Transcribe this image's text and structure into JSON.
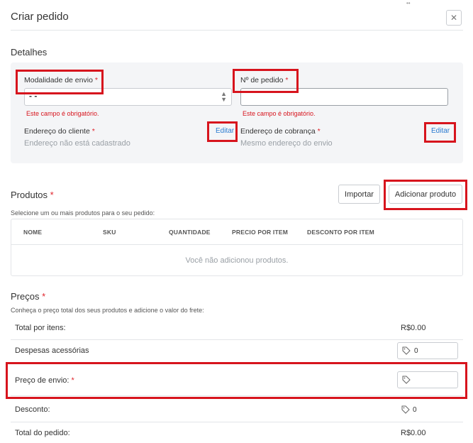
{
  "modal": {
    "title": "Criar pedido",
    "close_symbol": "✕"
  },
  "details": {
    "title": "Detalhes",
    "shipping_mode": {
      "label": "Modalidade de envio",
      "required": "*",
      "value": "- -",
      "error": "Este campo é obrigatório."
    },
    "order_number": {
      "label": "Nº de pedido",
      "required": "*",
      "value": "",
      "error": "Este campo é obrigatório."
    },
    "customer_address": {
      "label": "Endereço do cliente",
      "required": "*",
      "edit": "Editar",
      "value": "Endereço não está cadastrado"
    },
    "billing_address": {
      "label": "Endereço de cobrança",
      "required": "*",
      "edit": "Editar",
      "value": "Mesmo endereço do envio"
    }
  },
  "products": {
    "title": "Produtos",
    "required": "*",
    "subtitle": "Selecione um ou mais produtos para o seu pedido:",
    "import_label": "Importar",
    "add_label": "Adicionar produto",
    "columns": [
      "NOME",
      "SKU",
      "QUANTIDADE",
      "PRECIO POR ITEM",
      "DESCONTO POR ITEM"
    ],
    "empty_message": "Você não adicionou produtos."
  },
  "prices": {
    "title": "Preços",
    "required": "*",
    "subtitle": "Conheça o preço total dos seus produtos e adicione o valor do frete:",
    "total_items": {
      "label": "Total por itens:",
      "value": "R$0.00"
    },
    "extra_costs": {
      "label": "Despesas acessórias",
      "value": "0"
    },
    "shipping_price": {
      "label": "Preço de envio:",
      "required": "*",
      "value": ""
    },
    "discount": {
      "label": "Desconto:",
      "value": "0"
    },
    "order_total": {
      "label": "Total do pedido:",
      "value": "R$0.00"
    }
  },
  "icons": {
    "tag": "tag-icon",
    "close": "close-icon",
    "select_arrows": "sort-arrows-icon"
  },
  "colors": {
    "required": "#e0242c",
    "link": "#2a7bd0",
    "error": "#d7141d",
    "highlight": "#d7141d"
  }
}
